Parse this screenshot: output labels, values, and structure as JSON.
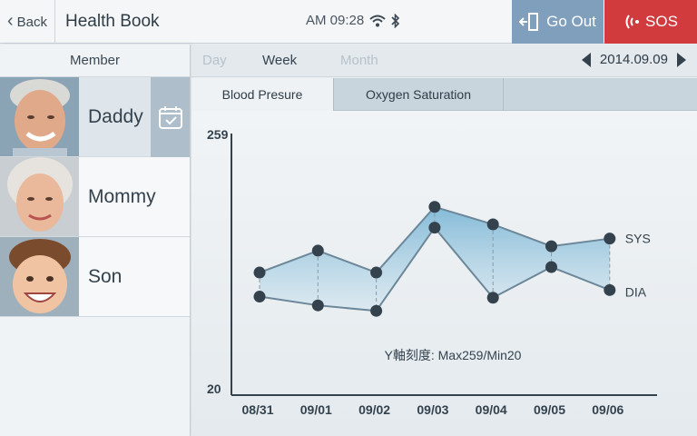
{
  "header": {
    "back_label": "Back",
    "title": "Health Book",
    "time": "AM 09:28",
    "icons": [
      "wifi-icon",
      "bluetooth-icon"
    ],
    "go_out_label": "Go Out",
    "sos_label": "SOS"
  },
  "sidebar": {
    "header": "Member",
    "members": [
      {
        "name": "Daddy",
        "active": true
      },
      {
        "name": "Mommy",
        "active": false
      },
      {
        "name": "Son",
        "active": false
      }
    ]
  },
  "period": {
    "options": [
      "Day",
      "Week",
      "Month"
    ],
    "selected": "Week",
    "date": "2014.09.09"
  },
  "chart_tabs": [
    "Blood Presure",
    "Oxygen Saturation"
  ],
  "colors": {
    "accent": "#7f9fbd",
    "sos": "#d13b3e",
    "line": "#6c8799",
    "point": "#34424d",
    "fill": "#8fc3dc"
  },
  "chart_data": {
    "type": "line",
    "categories": [
      "08/31",
      "09/01",
      "09/02",
      "09/03",
      "09/04",
      "09/05",
      "09/06"
    ],
    "series": [
      {
        "name": "SYS",
        "values": [
          132,
          152,
          132,
          192,
          176,
          156,
          163
        ]
      },
      {
        "name": "DIA",
        "values": [
          110,
          102,
          97,
          173,
          109,
          137,
          116
        ]
      }
    ],
    "ymax_label": "259",
    "ymin_label": "20",
    "ylim": [
      20,
      259
    ],
    "annotation": "Y軸刻度: Max259/Min20"
  }
}
